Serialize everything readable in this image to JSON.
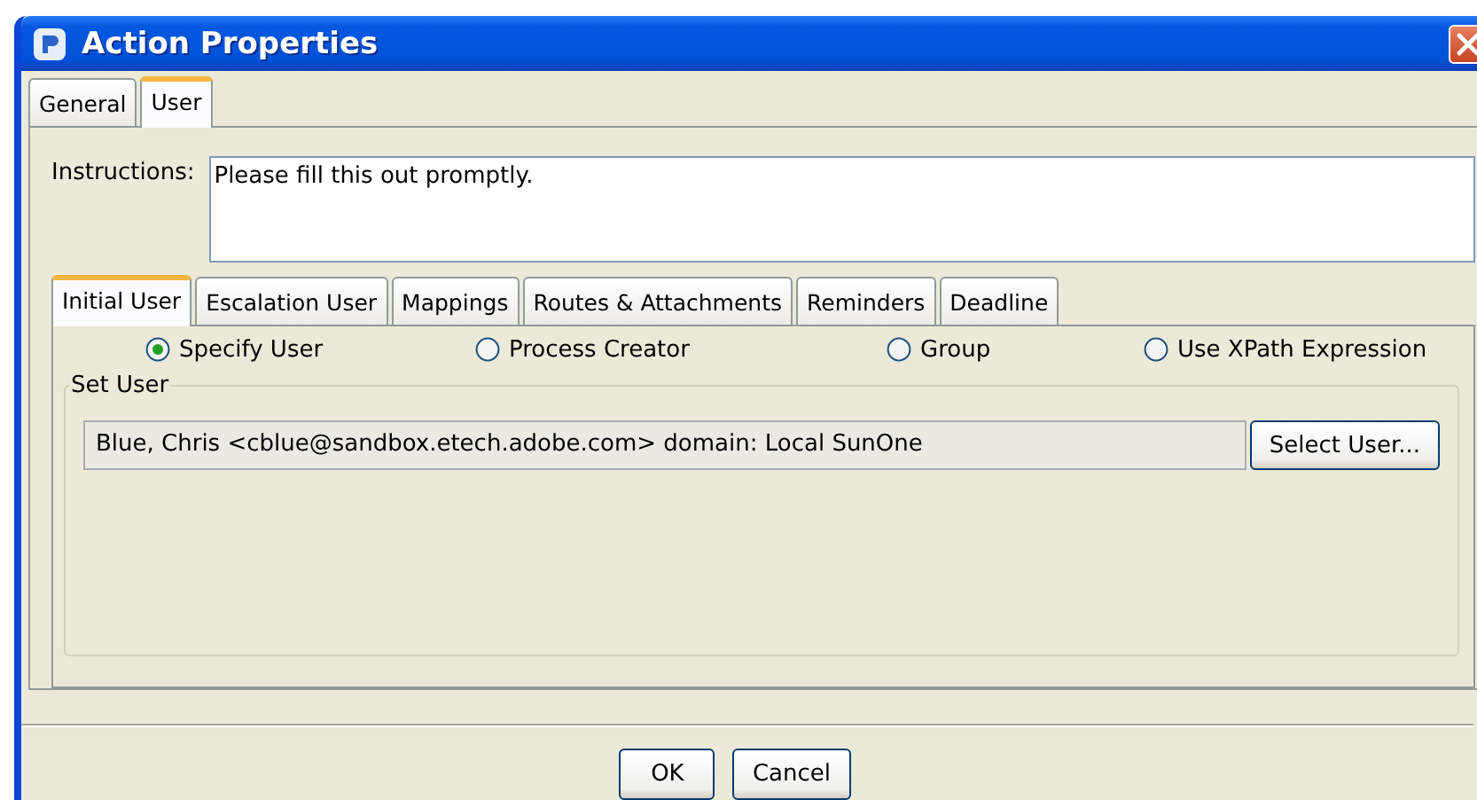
{
  "window": {
    "title": "Action Properties"
  },
  "tabs": [
    {
      "label": "General",
      "selected": false
    },
    {
      "label": "User",
      "selected": true
    }
  ],
  "instructions": {
    "label": "Instructions:",
    "value": "Please fill this out promptly."
  },
  "user_tabs": [
    {
      "label": "Initial User",
      "selected": true
    },
    {
      "label": "Escalation User",
      "selected": false
    },
    {
      "label": "Mappings",
      "selected": false
    },
    {
      "label": "Routes & Attachments",
      "selected": false
    },
    {
      "label": "Reminders",
      "selected": false
    },
    {
      "label": "Deadline",
      "selected": false
    }
  ],
  "assignment_options": [
    {
      "label": "Specify User",
      "selected": true
    },
    {
      "label": "Process Creator",
      "selected": false
    },
    {
      "label": "Group",
      "selected": false
    },
    {
      "label": "Use XPath Expression",
      "selected": false
    }
  ],
  "set_user": {
    "title": "Set User",
    "value": "Blue, Chris <cblue@sandbox.etech.adobe.com> domain: Local SunOne",
    "button": "Select User..."
  },
  "buttons": [
    "OK",
    "Cancel"
  ]
}
